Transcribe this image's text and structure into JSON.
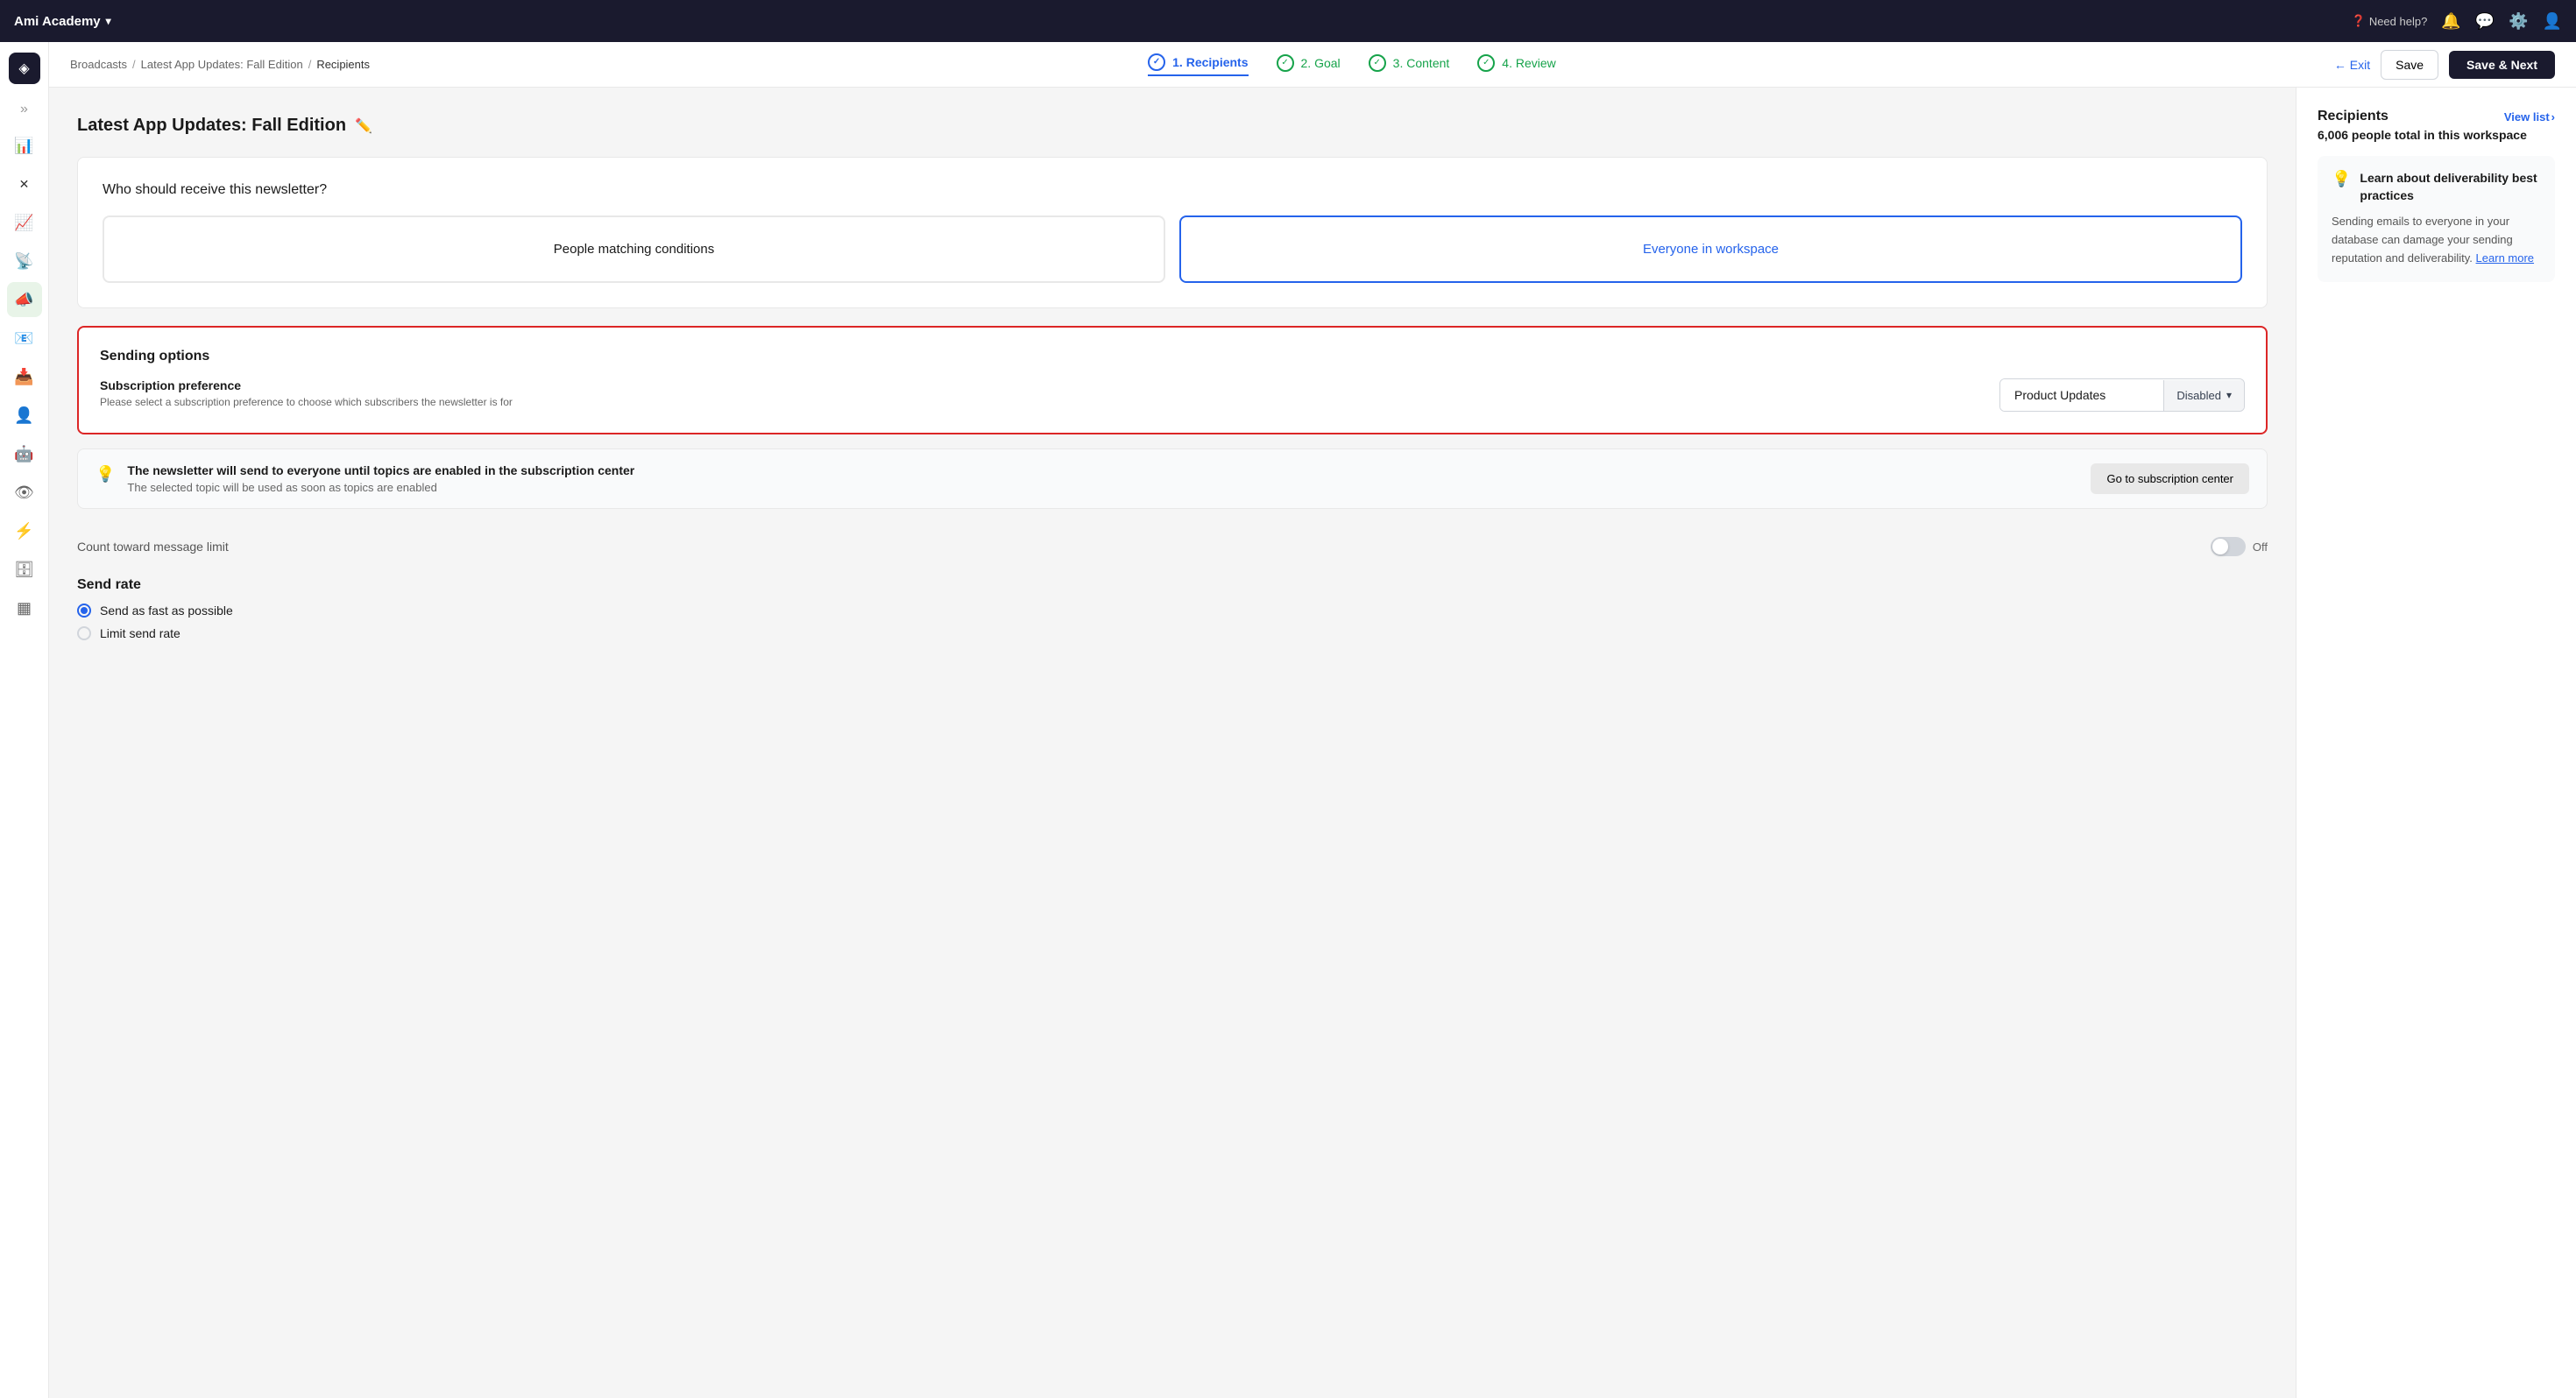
{
  "app": {
    "workspace_name": "Ami Academy",
    "workspace_chevron": "▾"
  },
  "topnav": {
    "help_label": "Need help?",
    "icons": [
      "🔔",
      "💬",
      "⚙️",
      "👤"
    ]
  },
  "breadcrumb": {
    "items": [
      "Broadcasts",
      "Latest App Updates: Fall Edition",
      "Recipients"
    ],
    "separators": [
      "/",
      "/"
    ]
  },
  "page_title": "Latest App Updates: Fall Edition",
  "steps": [
    {
      "id": "recipients",
      "number": "1.",
      "label": "Recipients",
      "state": "active"
    },
    {
      "id": "goal",
      "number": "2.",
      "label": "Goal",
      "state": "completed"
    },
    {
      "id": "content",
      "number": "3.",
      "label": "Content",
      "state": "completed"
    },
    {
      "id": "review",
      "number": "4.",
      "label": "Review",
      "state": "completed"
    }
  ],
  "header_actions": {
    "exit_label": "← Exit",
    "save_label": "Save",
    "save_next_label": "Save & Next"
  },
  "main": {
    "question": "Who should receive this newsletter?",
    "recipient_options": [
      {
        "id": "people_matching",
        "label": "People matching conditions",
        "selected": false
      },
      {
        "id": "everyone",
        "label": "Everyone in workspace",
        "selected": true
      }
    ],
    "sending_options": {
      "title": "Sending options",
      "subscription_label": "Subscription preference",
      "subscription_desc": "Please select a subscription preference to choose which subscribers the newsletter is for",
      "dropdown_value": "Product Updates",
      "dropdown_badge": "Disabled",
      "dropdown_chevron": "▾"
    },
    "warning": {
      "icon": "💡",
      "title": "The newsletter will send to everyone until topics are enabled in the subscription center",
      "desc": "The selected topic will be used as soon as topics are enabled",
      "action_label": "Go to subscription center"
    },
    "count_toward": {
      "label": "Count toward message limit",
      "toggle_state": "Off"
    },
    "send_rate": {
      "title": "Send rate",
      "options": [
        {
          "id": "fast",
          "label": "Send as fast as possible",
          "selected": true
        },
        {
          "id": "limit",
          "label": "Limit send rate",
          "selected": false
        }
      ]
    }
  },
  "right_panel": {
    "title": "Recipients",
    "view_list_label": "View list",
    "view_list_arrow": "›",
    "total_count": "6,006 people total in this workspace",
    "info_card": {
      "icon": "💡",
      "title": "Learn about deliverability best practices",
      "body": "Sending emails to everyone in your database can damage your sending reputation and deliverability.",
      "learn_more_label": "Learn more"
    }
  },
  "sidebar": {
    "logo_icon": "◈",
    "expand_icon": "»",
    "items": [
      {
        "icon": "📊",
        "label": "Dashboard",
        "active": false
      },
      {
        "icon": "✕",
        "label": "Close",
        "active": false
      },
      {
        "icon": "📈",
        "label": "Analytics",
        "active": false
      },
      {
        "icon": "📡",
        "label": "Broadcasts",
        "active": false
      },
      {
        "icon": "📣",
        "label": "Campaigns",
        "active": true
      },
      {
        "icon": "📧",
        "label": "Messages",
        "active": false
      },
      {
        "icon": "📥",
        "label": "Inbox",
        "active": false
      },
      {
        "icon": "👤",
        "label": "People",
        "active": false
      },
      {
        "icon": "🤖",
        "label": "Automations",
        "active": false
      },
      {
        "icon": "👁",
        "label": "Reports",
        "active": false
      },
      {
        "icon": "⚡",
        "label": "Activity",
        "active": false
      },
      {
        "icon": "🗄",
        "label": "Data",
        "active": false
      },
      {
        "icon": "▦",
        "label": "Grid",
        "active": false
      }
    ]
  }
}
